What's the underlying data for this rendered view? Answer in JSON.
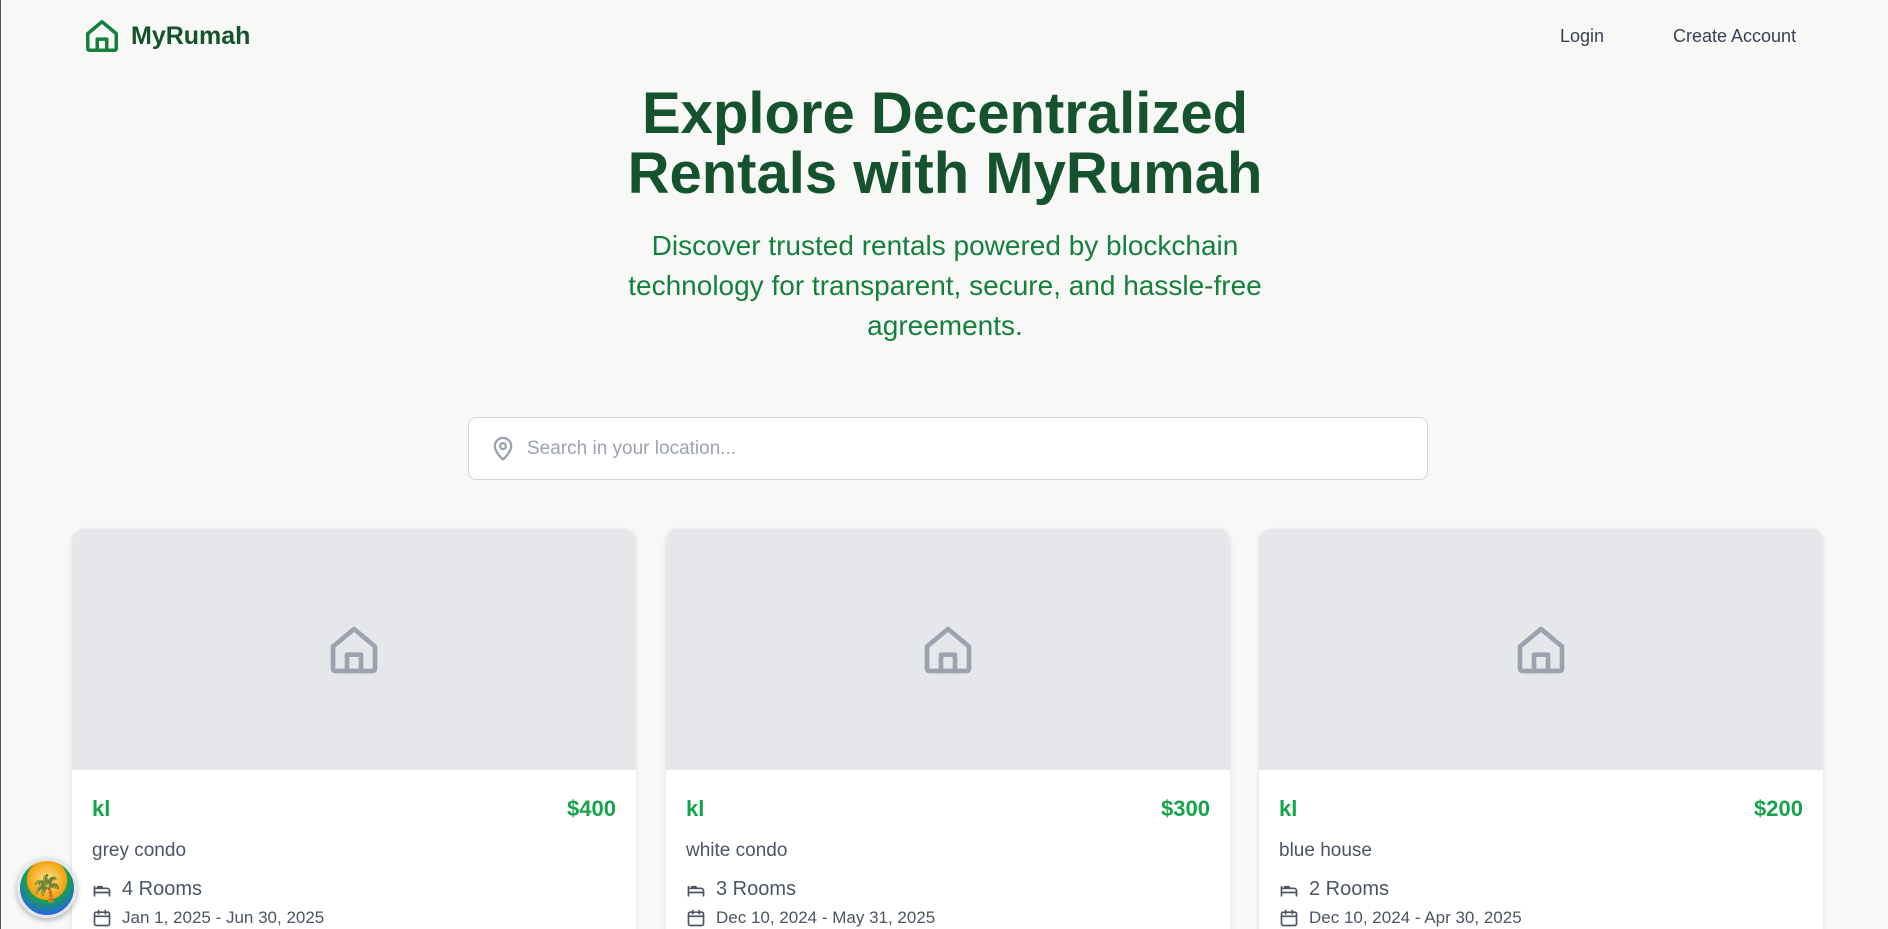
{
  "nav": {
    "brand": "MyRumah",
    "login_label": "Login",
    "create_account_label": "Create Account"
  },
  "hero": {
    "title_line1": "Explore Decentralized",
    "title_line2": "Rentals with MyRumah",
    "subtitle": "Discover trusted rentals powered by blockchain technology for transparent, secure, and hassle-free agreements."
  },
  "search": {
    "placeholder": "Search in your location...",
    "value": ""
  },
  "listings": [
    {
      "location": "kl",
      "price": "$400",
      "title": "grey condo",
      "rooms": "4 Rooms",
      "dates": "Jan 1, 2025 - Jun 30, 2025"
    },
    {
      "location": "kl",
      "price": "$300",
      "title": "white condo",
      "rooms": "3 Rooms",
      "dates": "Dec 10, 2024 - May 31, 2025"
    },
    {
      "location": "kl",
      "price": "$200",
      "title": "blue house",
      "rooms": "2 Rooms",
      "dates": "Dec 10, 2024 - Apr 30, 2025"
    }
  ],
  "colors": {
    "brand_dark": "#14532d",
    "brand": "#15803d",
    "accent": "#16a34a",
    "placeholder_bg": "#e5e7eb"
  },
  "icons": {
    "logo": "house-icon",
    "search": "map-pin-icon",
    "card_placeholder": "house-icon",
    "rooms": "bed-icon",
    "dates": "calendar-icon",
    "fab": "beach-avatar-icon"
  }
}
